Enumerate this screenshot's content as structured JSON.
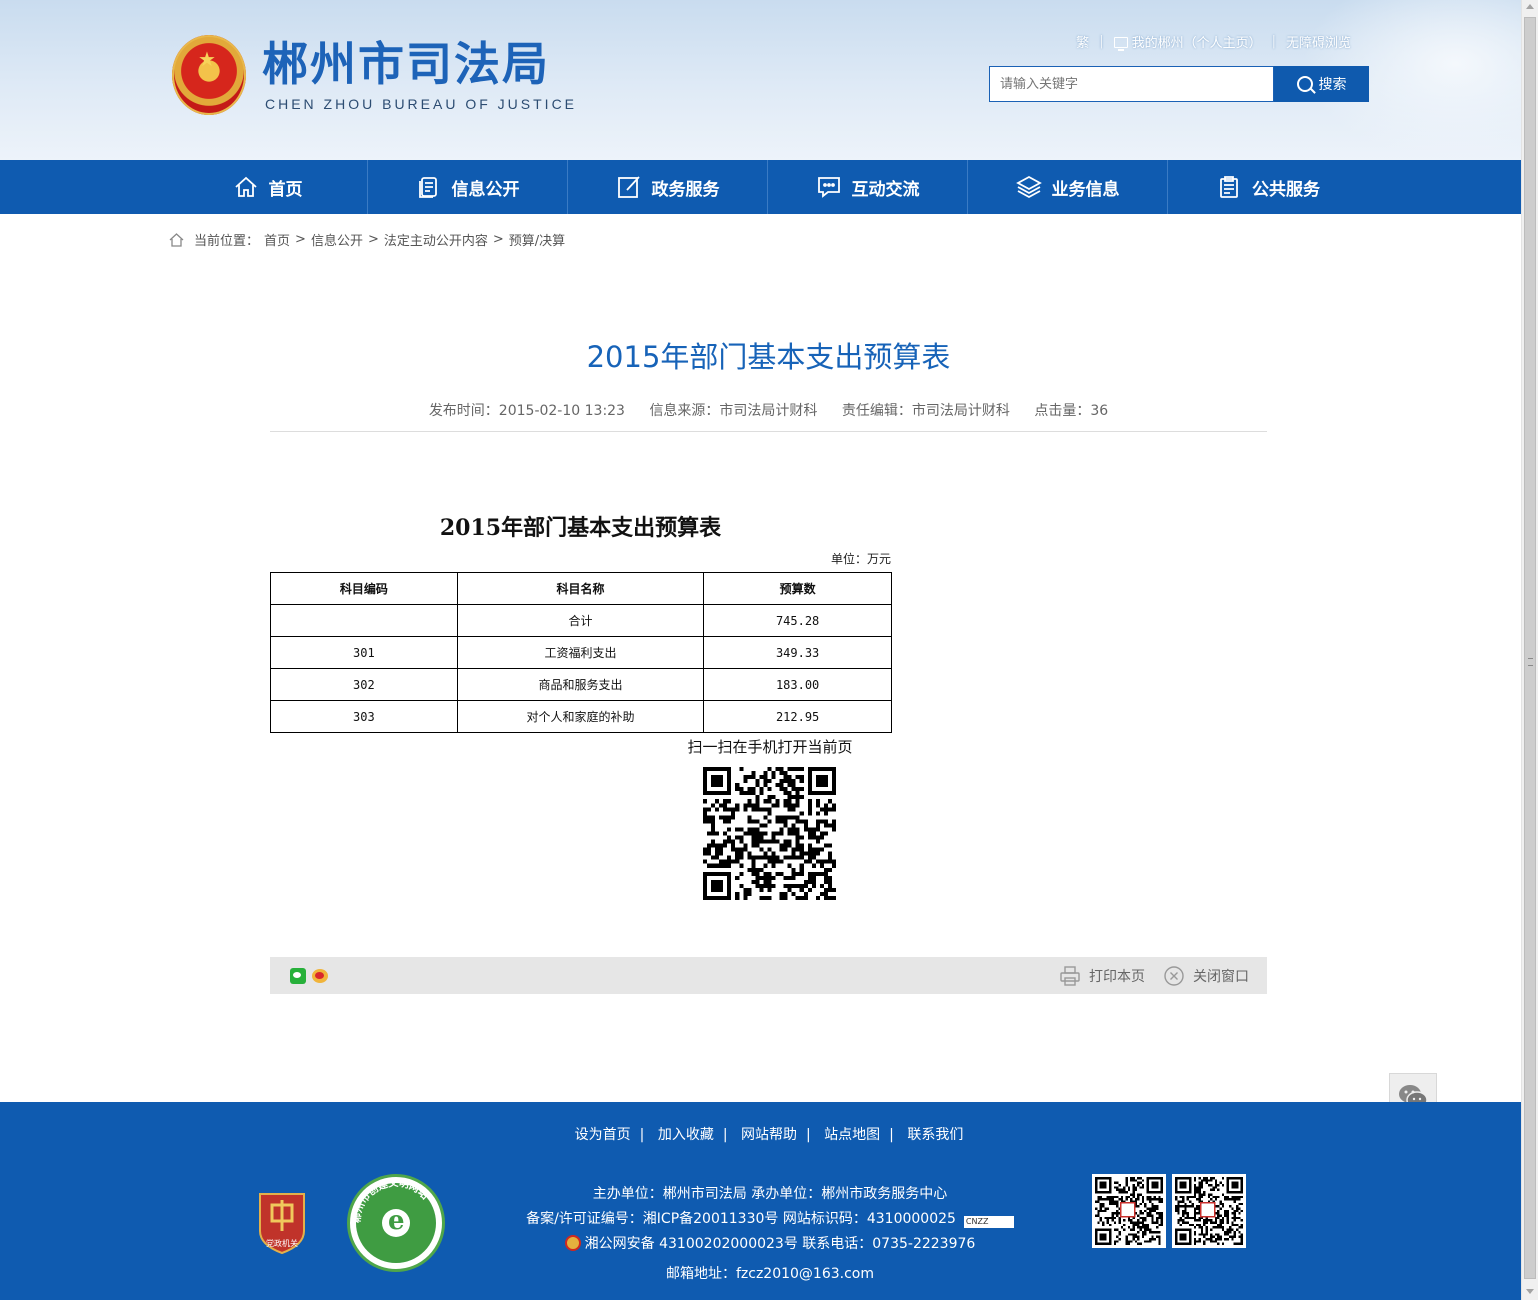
{
  "header": {
    "site_name": "郴州市司法局",
    "site_name_en": "CHEN ZHOU BUREAU OF JUSTICE",
    "toplinks": {
      "traditional": "繁",
      "my_chenzhou": "我的郴州（个人主页）",
      "accessibility": "无障碍浏览",
      "sep": "|"
    },
    "search": {
      "placeholder": "请输入关键字",
      "button": "搜索"
    }
  },
  "nav": {
    "items": [
      {
        "label": "首页",
        "icon": "home-icon"
      },
      {
        "label": "信息公开",
        "icon": "document-icon"
      },
      {
        "label": "政务服务",
        "icon": "edit-icon"
      },
      {
        "label": "互动交流",
        "icon": "chat-icon"
      },
      {
        "label": "业务信息",
        "icon": "layers-icon"
      },
      {
        "label": "公共服务",
        "icon": "clipboard-icon"
      }
    ]
  },
  "breadcrumb": {
    "prefix": "当前位置：",
    "items": [
      "首页",
      "信息公开",
      "法定主动公开内容",
      "预算/决算"
    ],
    "sep": ">"
  },
  "article": {
    "title": "2015年部门基本支出预算表",
    "meta": {
      "published": "发布时间：2015-02-10 13:23",
      "source": "信息来源：市司法局计财科",
      "editor": "责任编辑：市司法局计财科",
      "hits": "点击量：36"
    },
    "doc_title": "2015年部门基本支出预算表",
    "unit": "单位：万元",
    "table": {
      "headers": [
        "科目编码",
        "科目名称",
        "预算数"
      ],
      "rows": [
        [
          "",
          "合计",
          "745.28"
        ],
        [
          "301",
          "工资福利支出",
          "349.33"
        ],
        [
          "302",
          "商品和服务支出",
          "183.00"
        ],
        [
          "303",
          "对个人和家庭的补助",
          "212.95"
        ]
      ]
    },
    "qr_caption": "扫一扫在手机打开当前页"
  },
  "sharebar": {
    "print": "打印本页",
    "close": "关闭窗口"
  },
  "footer": {
    "links": [
      "设为首页",
      "加入收藏",
      "网站帮助",
      "站点地图",
      "联系我们"
    ],
    "sep": "|",
    "line1": "主办单位：郴州市司法局   承办单位：郴州市政务服务中心",
    "line2": "备案/许可证编号：湘ICP备20011330号   网站标识码：4310000025",
    "line3": "湘公网安备 43100202000023号   联系电话：0735-2223976",
    "line4": "邮箱地址：fzcz2010@163.com",
    "badge1_text": "党政机关",
    "badge2_text": "郴州市创建文明网站",
    "cnzz": "CNZZ"
  },
  "colors": {
    "brand_blue": "#0f5bb0",
    "title_blue": "#1763b8"
  }
}
